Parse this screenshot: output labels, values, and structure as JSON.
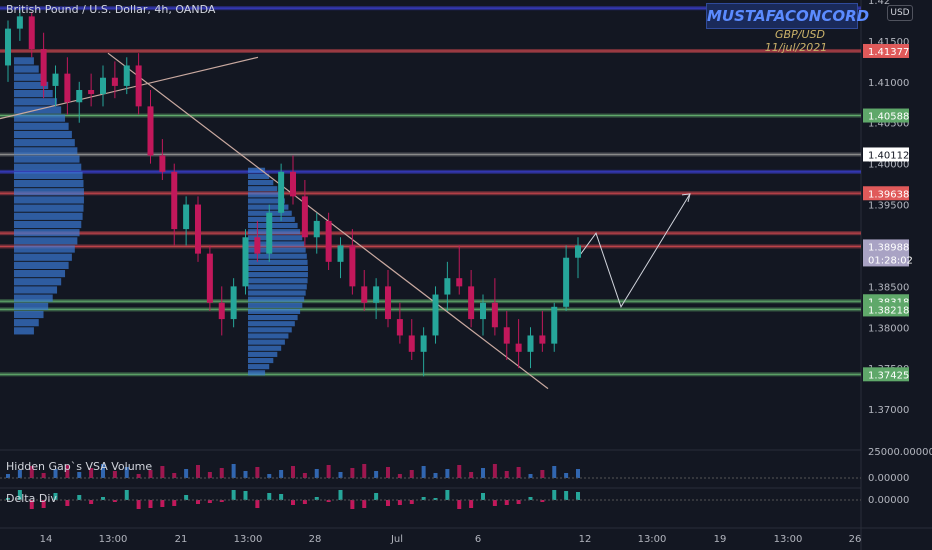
{
  "header": {
    "title": "British Pound / U.S. Dollar, 4h, OANDA",
    "brand": "MUSTAFACONCORD",
    "pair": "GBP/USD",
    "date": "11/jul/2021",
    "currency": "USD"
  },
  "panes": {
    "volume_label": "Hidden Gap`s VSA Volume",
    "delta_label": "Delta Div"
  },
  "chart_data": {
    "type": "candlestick",
    "instrument": "GBP/USD",
    "timeframe": "4h",
    "ylim": [
      1.365,
      1.42
    ],
    "y_ticks": [
      "1.37000",
      "1.37500",
      "1.38000",
      "1.38500",
      "1.39000",
      "1.39500",
      "1.40000",
      "1.40500",
      "1.41000",
      "1.41500",
      "1.42"
    ],
    "x_ticks": [
      "14",
      "13:00",
      "21",
      "13:00",
      "28",
      "Jul",
      "6",
      "12",
      "13:00",
      "19",
      "13:00",
      "26"
    ],
    "price_labels": [
      {
        "text": "1.41377",
        "value": 1.41377,
        "color": "#e05a5a"
      },
      {
        "text": "1.40588",
        "value": 1.40588,
        "color": "#5fa86a"
      },
      {
        "text": "1.40112",
        "value": 1.40112,
        "color": "#ffffff"
      },
      {
        "text": "1.39638",
        "value": 1.39638,
        "color": "#e05a5a"
      },
      {
        "text": "1.38988",
        "value": 1.38988,
        "color": "#a9a3c4"
      },
      {
        "text": "1.38318",
        "value": 1.38318,
        "color": "#5fa86a"
      },
      {
        "text": "1.38218",
        "value": 1.38218,
        "color": "#5fa86a"
      },
      {
        "text": "1.37425",
        "value": 1.37425,
        "color": "#5fa86a"
      }
    ],
    "countdown": "01:28:02",
    "horizontal_levels": [
      {
        "value": 1.419,
        "color": "#3b3fd1"
      },
      {
        "value": 1.41377,
        "color": "#c8454c"
      },
      {
        "value": 1.40588,
        "color": "#5fa86a"
      },
      {
        "value": 1.40112,
        "color": "#8a8a8a"
      },
      {
        "value": 1.399,
        "color": "#3b3fd1"
      },
      {
        "value": 1.39638,
        "color": "#c8454c"
      },
      {
        "value": 1.3915,
        "color": "#c8454c"
      },
      {
        "value": 1.38988,
        "color": "#c8454c"
      },
      {
        "value": 1.38318,
        "color": "#5fa86a"
      },
      {
        "value": 1.38218,
        "color": "#5fa86a"
      },
      {
        "value": 1.37425,
        "color": "#5fa86a"
      }
    ],
    "trendlines": [
      {
        "from": [
          0,
          1.4055
        ],
        "to": [
          258,
          1.413
        ],
        "color": "#c9a9a0"
      },
      {
        "from": [
          108,
          1.4135
        ],
        "to": [
          548,
          1.3725
        ],
        "color": "#c9a9a0"
      }
    ],
    "projection": [
      [
        578,
        1.3885
      ],
      [
        596,
        1.3915
      ],
      [
        621,
        1.3825
      ],
      [
        690,
        1.3963
      ]
    ],
    "candles": [
      [
        1.412,
        1.4175,
        1.41,
        1.4165
      ],
      [
        1.4165,
        1.419,
        1.415,
        1.418
      ],
      [
        1.418,
        1.4185,
        1.413,
        1.414
      ],
      [
        1.414,
        1.416,
        1.408,
        1.4095
      ],
      [
        1.4095,
        1.412,
        1.407,
        1.411
      ],
      [
        1.411,
        1.413,
        1.406,
        1.4075
      ],
      [
        1.4075,
        1.41,
        1.405,
        1.409
      ],
      [
        1.409,
        1.411,
        1.407,
        1.4085
      ],
      [
        1.4085,
        1.412,
        1.407,
        1.4105
      ],
      [
        1.4105,
        1.4125,
        1.408,
        1.4095
      ],
      [
        1.4095,
        1.413,
        1.4085,
        1.412
      ],
      [
        1.412,
        1.4135,
        1.406,
        1.407
      ],
      [
        1.407,
        1.409,
        1.4,
        1.401
      ],
      [
        1.401,
        1.403,
        1.398,
        1.399
      ],
      [
        1.399,
        1.4,
        1.39,
        1.392
      ],
      [
        1.392,
        1.396,
        1.39,
        1.395
      ],
      [
        1.395,
        1.396,
        1.388,
        1.389
      ],
      [
        1.389,
        1.39,
        1.382,
        1.383
      ],
      [
        1.383,
        1.385,
        1.379,
        1.381
      ],
      [
        1.381,
        1.386,
        1.38,
        1.385
      ],
      [
        1.385,
        1.392,
        1.384,
        1.391
      ],
      [
        1.391,
        1.393,
        1.388,
        1.389
      ],
      [
        1.389,
        1.395,
        1.388,
        1.394
      ],
      [
        1.394,
        1.4,
        1.393,
        1.399
      ],
      [
        1.399,
        1.401,
        1.395,
        1.396
      ],
      [
        1.396,
        1.398,
        1.39,
        1.391
      ],
      [
        1.391,
        1.394,
        1.389,
        1.393
      ],
      [
        1.393,
        1.394,
        1.387,
        1.388
      ],
      [
        1.388,
        1.391,
        1.386,
        1.39
      ],
      [
        1.39,
        1.392,
        1.384,
        1.385
      ],
      [
        1.385,
        1.387,
        1.382,
        1.383
      ],
      [
        1.383,
        1.386,
        1.381,
        1.385
      ],
      [
        1.385,
        1.387,
        1.38,
        1.381
      ],
      [
        1.381,
        1.383,
        1.378,
        1.379
      ],
      [
        1.379,
        1.381,
        1.376,
        1.377
      ],
      [
        1.377,
        1.38,
        1.374,
        1.379
      ],
      [
        1.379,
        1.385,
        1.378,
        1.384
      ],
      [
        1.384,
        1.388,
        1.382,
        1.386
      ],
      [
        1.386,
        1.39,
        1.384,
        1.385
      ],
      [
        1.385,
        1.387,
        1.38,
        1.381
      ],
      [
        1.381,
        1.384,
        1.379,
        1.383
      ],
      [
        1.383,
        1.386,
        1.379,
        1.38
      ],
      [
        1.38,
        1.382,
        1.376,
        1.378
      ],
      [
        1.378,
        1.381,
        1.375,
        1.377
      ],
      [
        1.377,
        1.38,
        1.375,
        1.379
      ],
      [
        1.379,
        1.382,
        1.377,
        1.378
      ],
      [
        1.378,
        1.383,
        1.377,
        1.3825
      ],
      [
        1.3825,
        1.39,
        1.382,
        1.3885
      ],
      [
        1.3885,
        1.391,
        1.386,
        1.39
      ]
    ]
  }
}
